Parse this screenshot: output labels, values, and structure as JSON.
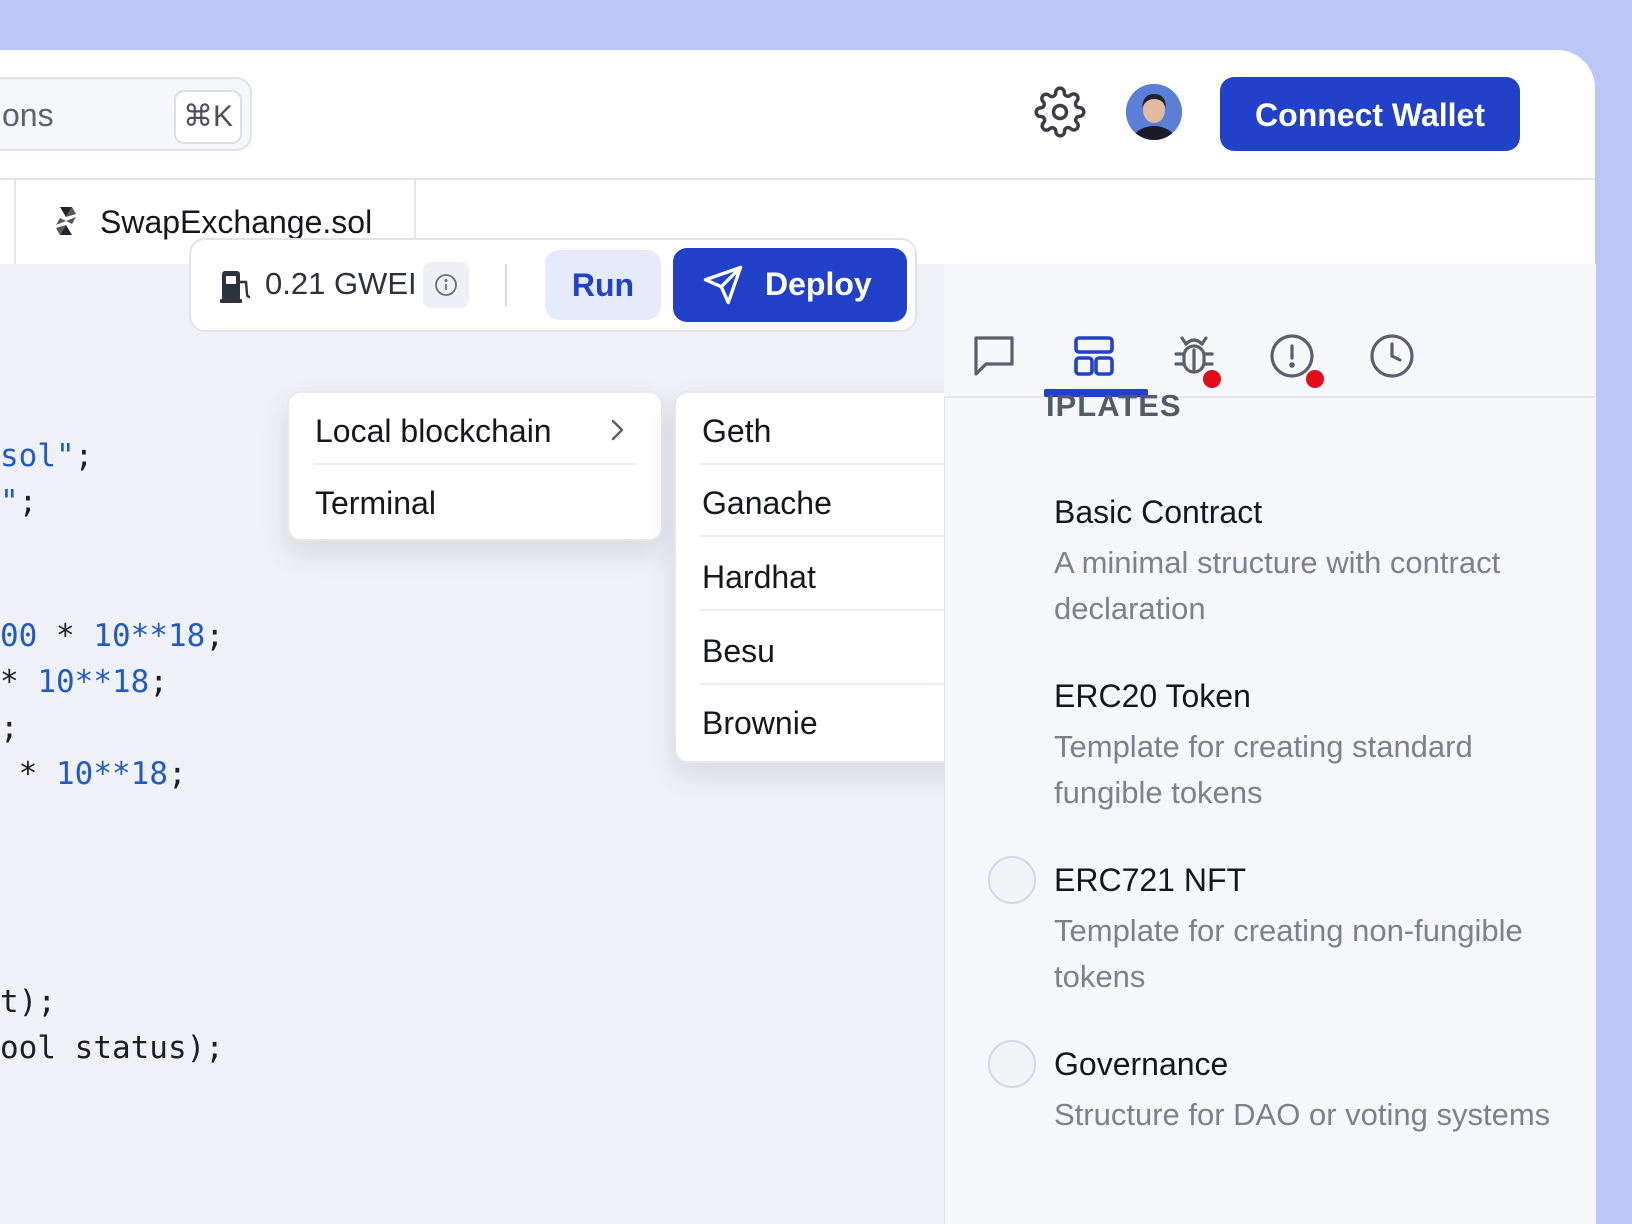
{
  "header": {
    "search_text": "ons",
    "search_shortcut": "⌘K",
    "settings_icon": "gear-icon",
    "connect_wallet_label": "Connect Wallet"
  },
  "file_tab": {
    "name": "SwapExchange.sol",
    "icon": "solidity-icon"
  },
  "toolbar": {
    "gas_price": "0.21 GWEI",
    "run_label": "Run",
    "deploy_label": "Deploy"
  },
  "code": {
    "lines": [
      {
        "pre": "",
        "str": "sol\"",
        "post": ";"
      },
      {
        "pre": "",
        "str": "\"",
        "post": ";"
      },
      {
        "pre": "",
        "num1": "00",
        "mid": " * ",
        "num2": "10**18",
        "post": ";"
      },
      {
        "pre": "* ",
        "num2": "10**18",
        "post": ";"
      },
      {
        "text": ";"
      },
      {
        "pre": " * ",
        "num2": "10**18",
        "post": ";"
      },
      {
        "text": "t);"
      },
      {
        "text": "ool status);"
      }
    ]
  },
  "deploy_menu": {
    "items": [
      {
        "label": "Local blockchain",
        "has_submenu": true
      },
      {
        "label": "Terminal"
      }
    ]
  },
  "local_blockchain_submenu": {
    "items": [
      "Geth",
      "Ganache",
      "Hardhat",
      "Besu",
      "Brownie"
    ]
  },
  "side_panel": {
    "tabs": [
      {
        "name": "chat-icon"
      },
      {
        "name": "templates-icon",
        "active": true
      },
      {
        "name": "debug-icon",
        "alert": true
      },
      {
        "name": "alert-icon",
        "alert": true
      },
      {
        "name": "history-icon"
      }
    ],
    "section_title": "IPLATES",
    "templates": [
      {
        "title": "Basic Contract",
        "description": "A minimal structure with contract declaration"
      },
      {
        "title": "ERC20 Token",
        "description": "Template for creating standard fungible tokens"
      },
      {
        "title": "ERC721 NFT",
        "description": "Template for creating non-fungible tokens"
      },
      {
        "title": "Governance",
        "description": "Structure for DAO or voting systems"
      }
    ]
  },
  "colors": {
    "accent": "#2241c9",
    "background": "#bcc6f8",
    "alert_dot": "#e10d18",
    "code_number": "#1e5bc6"
  }
}
